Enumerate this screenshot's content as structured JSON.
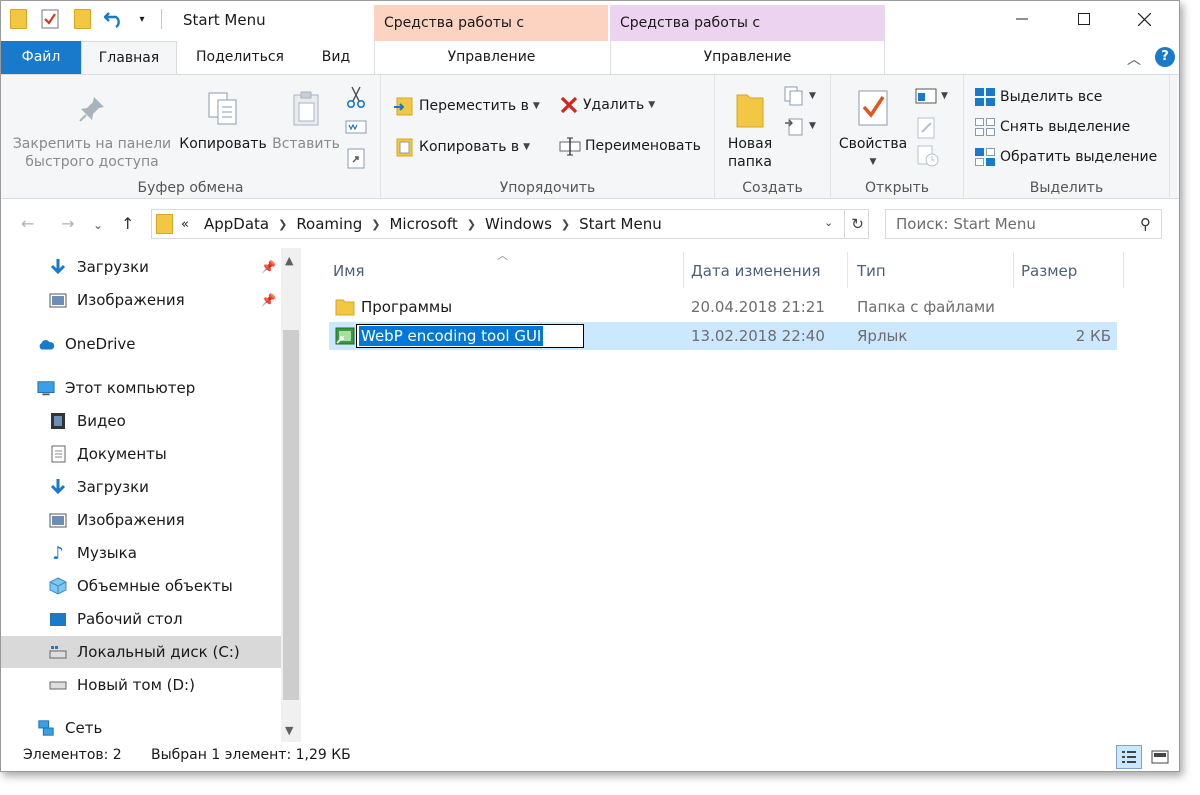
{
  "window": {
    "title": "Start Menu",
    "context_tab_shortcut": "Средства работы с ярлыками",
    "context_tab_app": "Средства работы с приложениями"
  },
  "tabs": {
    "file": "Файл",
    "home": "Главная",
    "share": "Поделиться",
    "view": "Вид",
    "manage1": "Управление",
    "manage2": "Управление"
  },
  "ribbon": {
    "clipboard": {
      "pin_label_1": "Закрепить на панели",
      "pin_label_2": "быстрого доступа",
      "copy": "Копировать",
      "paste": "Вставить",
      "group": "Буфер обмена"
    },
    "organize": {
      "move_to": "Переместить в",
      "copy_to": "Копировать в",
      "delete": "Удалить",
      "rename": "Переименовать",
      "group": "Упорядочить"
    },
    "new": {
      "new_folder_1": "Новая",
      "new_folder_2": "папка",
      "group": "Создать"
    },
    "open": {
      "properties": "Свойства",
      "group": "Открыть"
    },
    "select": {
      "select_all": "Выделить все",
      "select_none": "Снять выделение",
      "invert": "Обратить выделение",
      "group": "Выделить"
    }
  },
  "address": {
    "prefix": "«",
    "crumbs": [
      "AppData",
      "Roaming",
      "Microsoft",
      "Windows",
      "Start Menu"
    ],
    "search_placeholder": "Поиск: Start Menu"
  },
  "nav": {
    "items": [
      {
        "label": "Загрузки",
        "icon": "download-icon"
      },
      {
        "label": "Изображения",
        "icon": "pictures-icon"
      },
      {
        "label": "OneDrive",
        "icon": "cloud-icon"
      },
      {
        "label": "Этот компьютер",
        "icon": "computer-icon"
      },
      {
        "label": "Видео",
        "icon": "video-icon"
      },
      {
        "label": "Документы",
        "icon": "documents-icon"
      },
      {
        "label": "Загрузки",
        "icon": "download-icon"
      },
      {
        "label": "Изображения",
        "icon": "pictures-icon"
      },
      {
        "label": "Музыка",
        "icon": "music-icon"
      },
      {
        "label": "Объемные объекты",
        "icon": "3d-objects-icon"
      },
      {
        "label": "Рабочий стол",
        "icon": "desktop-icon"
      },
      {
        "label": "Локальный диск (C:)",
        "icon": "drive-icon"
      },
      {
        "label": "Новый том (D:)",
        "icon": "drive-icon"
      },
      {
        "label": "Сеть",
        "icon": "network-icon"
      }
    ]
  },
  "columns": {
    "name": "Имя",
    "date": "Дата изменения",
    "type": "Тип",
    "size": "Размер"
  },
  "files": [
    {
      "name": "Программы",
      "date": "20.04.2018 21:21",
      "type": "Папка с файлами",
      "size": ""
    },
    {
      "name": "WebP encoding tool GUI",
      "date": "13.02.2018 22:40",
      "type": "Ярлык",
      "size": "2 КБ"
    }
  ],
  "status": {
    "count": "Элементов: 2",
    "selection": "Выбран 1 элемент: 1,29 КБ"
  },
  "colors": {
    "accent": "#1979ca",
    "selection": "#cce8ff",
    "context_shortcut": "#fbd3c0",
    "context_app": "#ecd3ef"
  }
}
